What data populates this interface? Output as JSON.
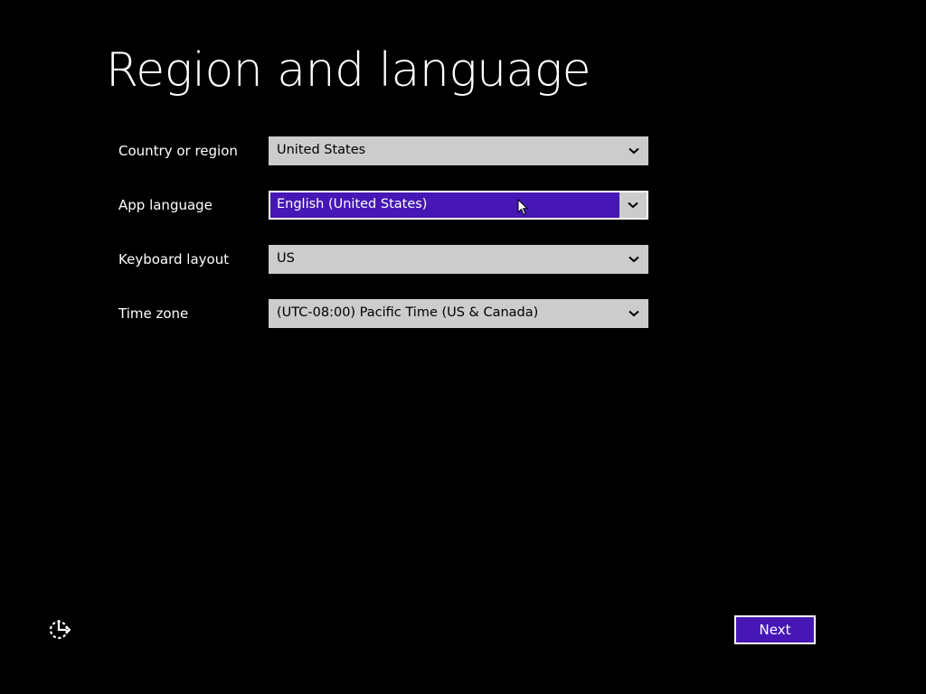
{
  "page": {
    "title": "Region and language"
  },
  "fields": [
    {
      "label": "Country or region",
      "value": "United States"
    },
    {
      "label": "App language",
      "value": "English (United States)"
    },
    {
      "label": "Keyboard layout",
      "value": "US"
    },
    {
      "label": "Time zone",
      "value": "(UTC-08:00) Pacific Time (US & Canada)"
    }
  ],
  "footer": {
    "next_label": "Next",
    "ease_of_access_icon": "ease-of-access-icon"
  },
  "colors": {
    "background": "#000000",
    "accent": "#4617b4",
    "field_background": "#cccccc",
    "text": "#ffffff"
  },
  "icons": {
    "dropdown": "chevron-down-icon",
    "pointer": "mouse-pointer-icon"
  }
}
